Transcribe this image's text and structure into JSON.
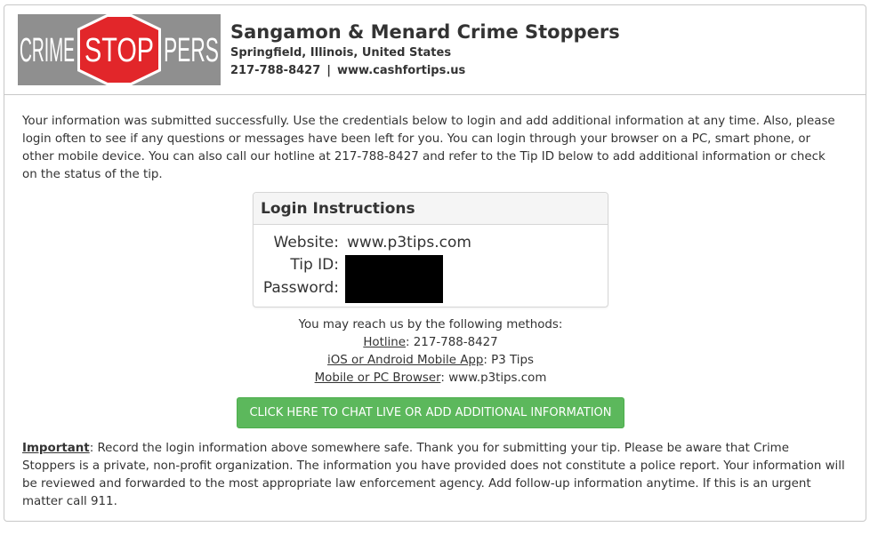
{
  "header": {
    "logo": {
      "text_left": "CRIME",
      "text_stop": "STOP",
      "text_right": "PERS",
      "bg_color": "#8f8f8f",
      "stop_color": "#e2262a"
    },
    "org_name": "Sangamon & Menard Crime Stoppers",
    "location": "Springfield, Illinois, United States",
    "phone": "217-788-8427",
    "separator": "|",
    "website": "www.cashfortips.us"
  },
  "intro": "Your information was submitted successfully. Use the credentials below to login and add additional information at any time. Also, please login often to see if any questions or messages have been left for you. You can login through your browser on a PC, smart phone, or other mobile device. You can also call our hotline at 217-788-8427 and refer to the Tip ID below to add additional information or check on the status of the tip.",
  "login": {
    "title": "Login Instructions",
    "website_label": "Website:",
    "website_value": "www.p3tips.com",
    "tip_id_label": "Tip ID:",
    "password_label": "Password:"
  },
  "methods": {
    "heading": "You may reach us by the following methods:",
    "hotline_label": "Hotline",
    "hotline_value": ": 217-788-8427",
    "app_label": "iOS or Android Mobile App",
    "app_value": ": P3 Tips",
    "browser_label": "Mobile or PC Browser",
    "browser_value": ": www.p3tips.com"
  },
  "cta": {
    "label": "CLICK HERE TO CHAT LIVE OR ADD ADDITIONAL INFORMATION",
    "color": "#5cb85c"
  },
  "footer": {
    "important_label": "Important",
    "important_text": ": Record the login information above somewhere safe. Thank you for submitting your tip. Please be aware that Crime Stoppers is a private, non-profit organization. The information you have provided does not constitute a police report. Your information will be reviewed and forwarded to the most appropriate law enforcement agency. Add follow-up information anytime. If this is an urgent matter call 911."
  }
}
